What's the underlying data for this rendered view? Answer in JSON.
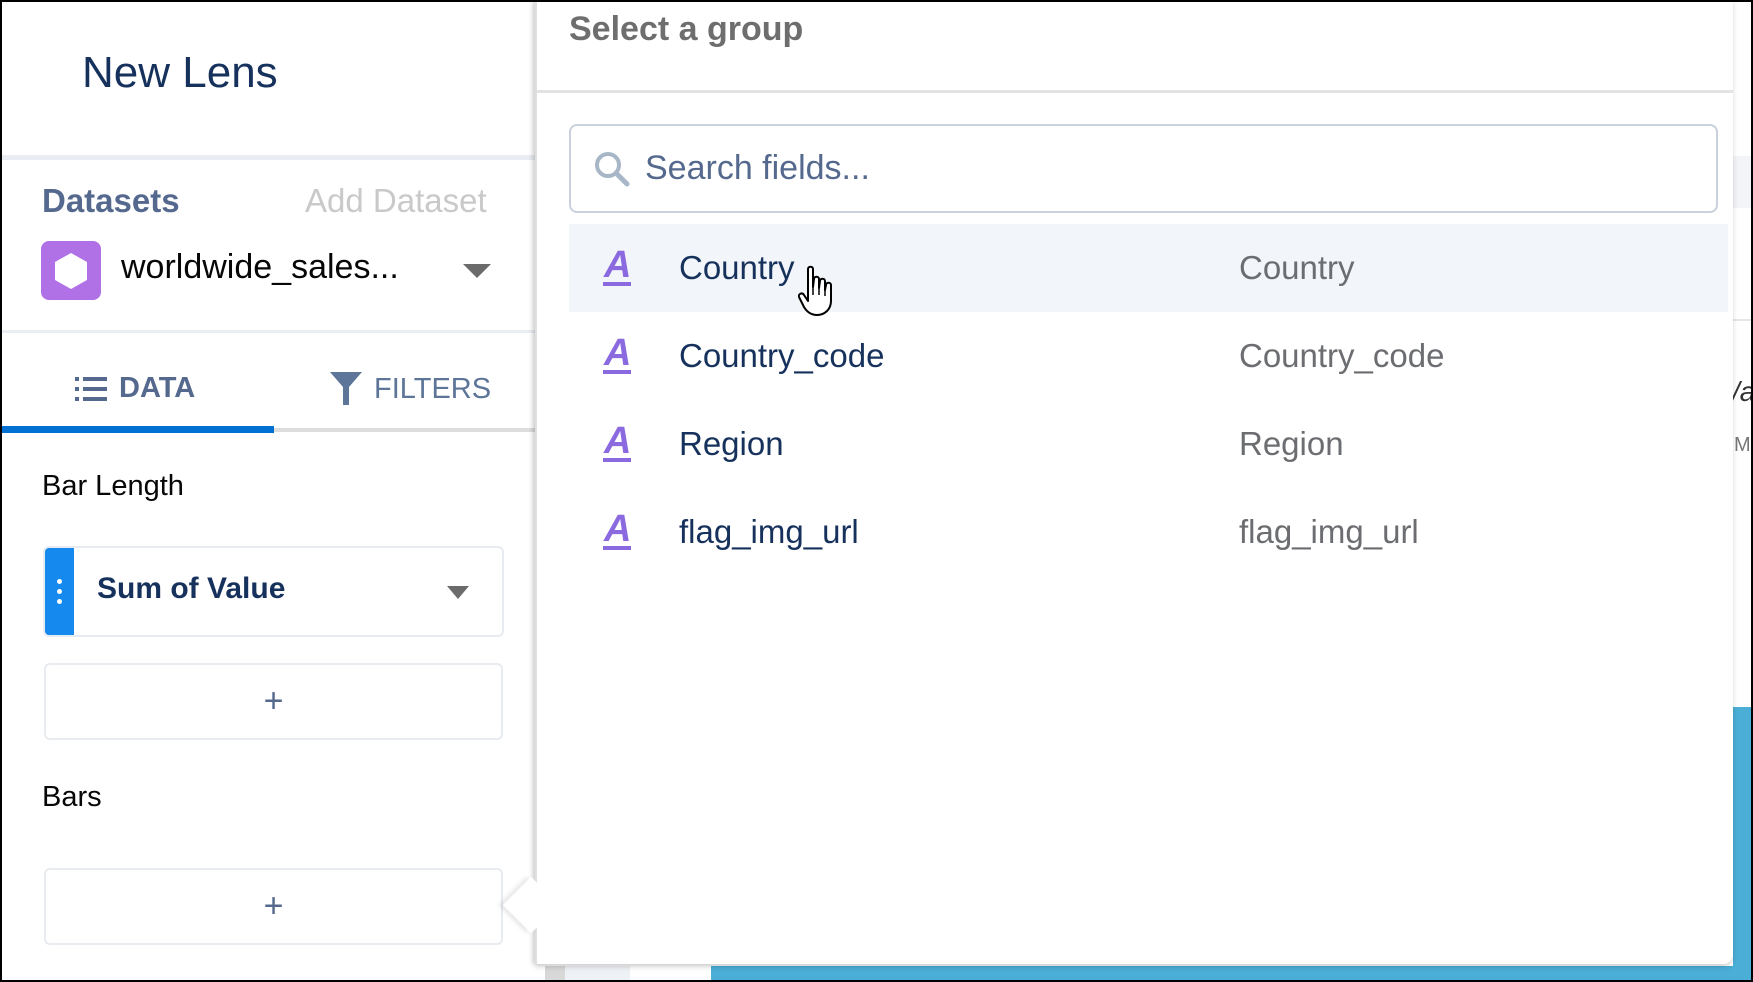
{
  "sidebar": {
    "title": "New Lens",
    "datasets_label": "Datasets",
    "add_dataset_label": "Add Dataset",
    "dataset": {
      "name": "worldwide_sales...",
      "icon": "dataset-hexagon-icon",
      "icon_color": "#b070e6"
    },
    "tabs": [
      {
        "label": "DATA",
        "icon": "list-icon",
        "active": true
      },
      {
        "label": "FILTERS",
        "icon": "filter-icon",
        "active": false
      }
    ],
    "sections": [
      {
        "label": "Bar Length",
        "pills": [
          {
            "label": "Sum of Value"
          }
        ],
        "add_label": "+"
      },
      {
        "label": "Bars",
        "pills": [],
        "add_label": "+"
      }
    ],
    "accent_color": "#0070d2"
  },
  "popover": {
    "title": "Select a group",
    "search": {
      "placeholder": "Search fields...",
      "value": ""
    },
    "fields": [
      {
        "name": "Country",
        "label": "Country",
        "type_icon": "text-dimension-icon",
        "hovered": true
      },
      {
        "name": "Country_code",
        "label": "Country_code",
        "type_icon": "text-dimension-icon",
        "hovered": false
      },
      {
        "name": "Region",
        "label": "Region",
        "type_icon": "text-dimension-icon",
        "hovered": false
      },
      {
        "name": "flag_img_url",
        "label": "flag_img_url",
        "type_icon": "text-dimension-icon",
        "hovered": false
      }
    ],
    "dimension_icon_color": "#8b6ae0"
  },
  "background": {
    "partial_text_1": "/a",
    "partial_text_2": "M",
    "bar_color": "#4aaed6"
  }
}
